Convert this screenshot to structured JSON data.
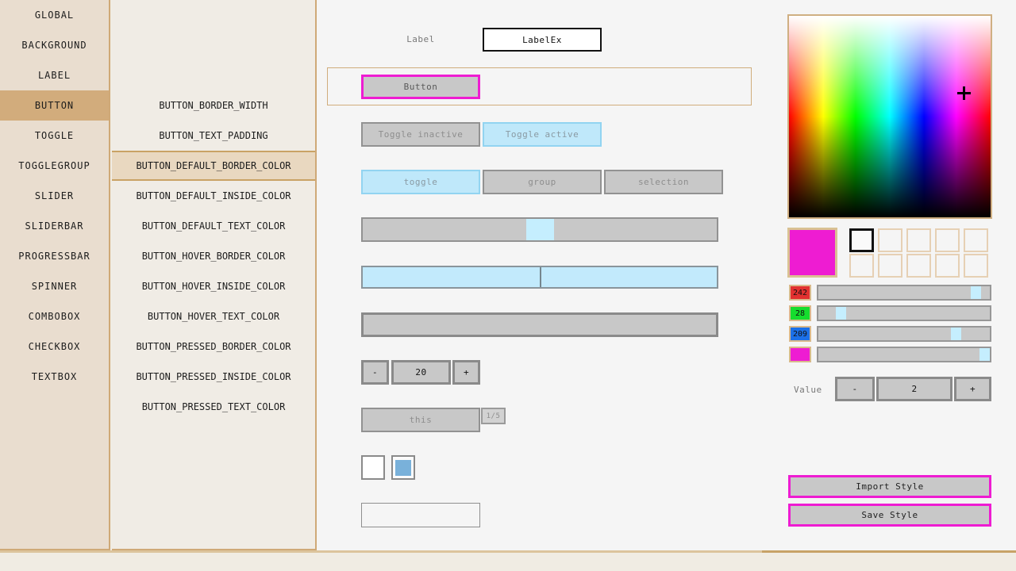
{
  "colors": {
    "accent": "#ee1cd2",
    "red_swatch": "#e23130",
    "green_swatch": "#15dd2e",
    "blue_swatch": "#1c70e8"
  },
  "sidebar": {
    "items": [
      "GLOBAL",
      "BACKGROUND",
      "LABEL",
      "BUTTON",
      "TOGGLE",
      "TOGGLEGROUP",
      "SLIDER",
      "SLIDERBAR",
      "PROGRESSBAR",
      "SPINNER",
      "COMBOBOX",
      "CHECKBOX",
      "TEXTBOX"
    ],
    "selected": "BUTTON"
  },
  "properties": {
    "items": [
      "BUTTON_BORDER_WIDTH",
      "BUTTON_TEXT_PADDING",
      "BUTTON_DEFAULT_BORDER_COLOR",
      "BUTTON_DEFAULT_INSIDE_COLOR",
      "BUTTON_DEFAULT_TEXT_COLOR",
      "BUTTON_HOVER_BORDER_COLOR",
      "BUTTON_HOVER_INSIDE_COLOR",
      "BUTTON_HOVER_TEXT_COLOR",
      "BUTTON_PRESSED_BORDER_COLOR",
      "BUTTON_PRESSED_INSIDE_COLOR",
      "BUTTON_PRESSED_TEXT_COLOR"
    ],
    "selected": "BUTTON_DEFAULT_BORDER_COLOR"
  },
  "preview": {
    "label_caption": "Label",
    "label_value": "LabelEx",
    "button_label": "Button",
    "toggle_inactive": "Toggle inactive",
    "toggle_active": "Toggle active",
    "togglegroup": [
      "toggle",
      "group",
      "selection"
    ],
    "slider": {
      "pct": 50
    },
    "spinner": {
      "minus": "-",
      "value": "20",
      "plus": "+"
    },
    "combobox": {
      "label": "this",
      "page": "1/5"
    }
  },
  "color_panel": {
    "channels": [
      {
        "value": "242",
        "swatch": "#e23130",
        "pct": 94.6
      },
      {
        "value": "28",
        "swatch": "#15dd2e",
        "pct": 10.8
      },
      {
        "value": "209",
        "swatch": "#1c70e8",
        "pct": 82.3
      },
      {
        "value": "",
        "swatch": "#ee1cd2",
        "pct": 100
      }
    ],
    "value_label": "Value",
    "value_spinner": {
      "minus": "-",
      "value": "2",
      "plus": "+"
    },
    "import_label": "Import Style",
    "save_label": "Save Style"
  }
}
